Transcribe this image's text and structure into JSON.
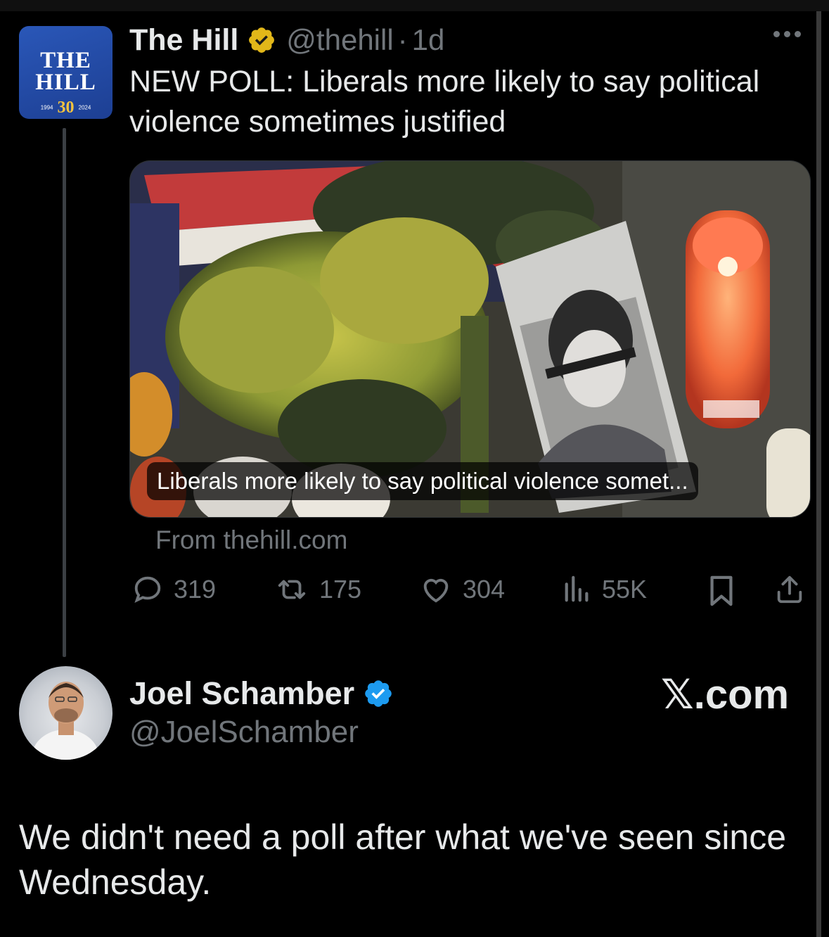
{
  "original_tweet": {
    "logo": {
      "line1": "THE",
      "line2": "HILL",
      "year_start": "1994",
      "anniversary": "30",
      "year_end": "2024"
    },
    "author_name": "The Hill",
    "verified_badge": "gold-verified-icon",
    "handle": "@thehill",
    "separator": "·",
    "age": "1d",
    "text": "NEW POLL: Liberals more likely to say political violence sometimes justified",
    "card": {
      "caption": "Liberals more likely to say political violence somet...",
      "source": "From thehill.com"
    },
    "actions": {
      "replies": "319",
      "reposts": "175",
      "likes": "304",
      "views": "55K"
    }
  },
  "reply": {
    "author_name": "Joel Schamber",
    "verified_badge": "blue-verified-icon",
    "handle": "@JoelSchamber",
    "watermark": "𝕏.com",
    "text": "We didn't need a poll after what we've seen since Wednesday."
  },
  "colors": {
    "background": "#000000",
    "text": "#e7e9ea",
    "muted": "#71767b",
    "gold_badge": "#e2b719",
    "blue_badge": "#1d9bf0"
  }
}
